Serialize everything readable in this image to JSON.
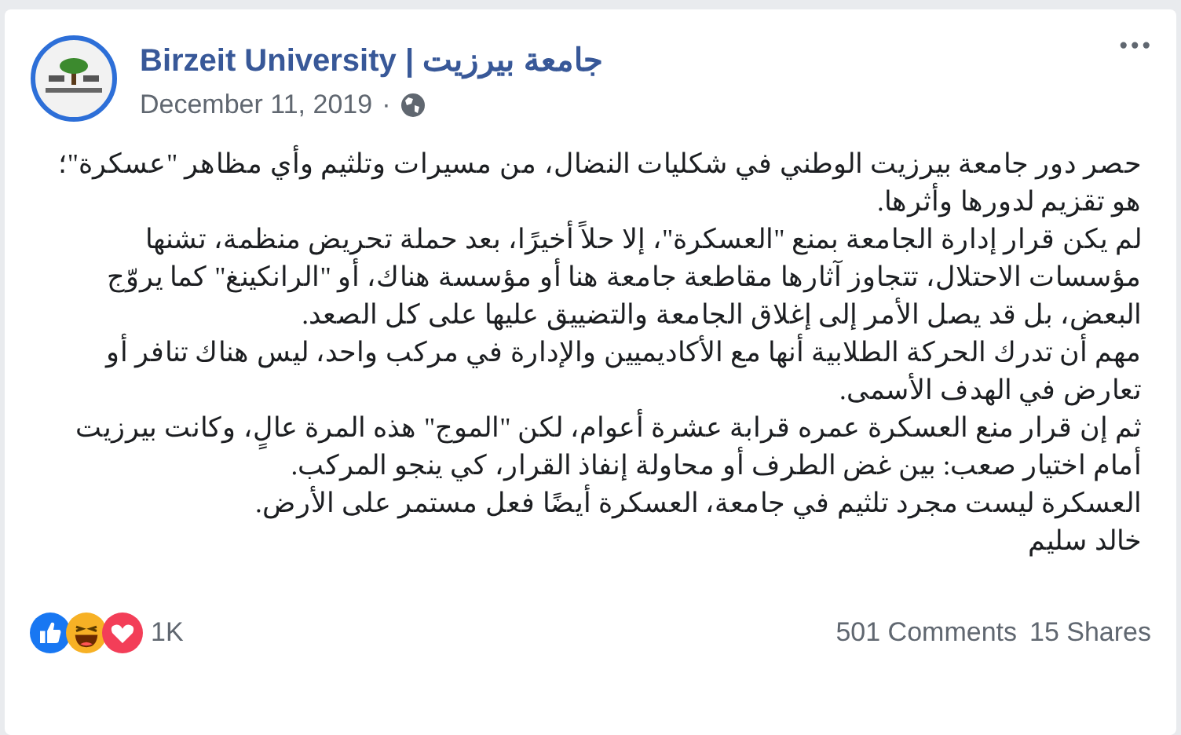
{
  "post": {
    "author": "Birzeit University | جامعة بيرزيت",
    "date": "December 11, 2019",
    "separator": "·",
    "more": "•••",
    "paragraphs": [
      "حصر دور جامعة بيرزيت الوطني في شكليات النضال، من مسيرات وتلثيم وأي مظاهر \"عسكرة\"؛ هو تقزيم لدورها وأثرها.",
      "لم يكن قرار إدارة الجامعة بمنع \"العسكرة\"، إلا حلاً أخيرًا، بعد حملة تحريض منظمة، تشنها مؤسسات الاحتلال، تتجاوز آثارها مقاطعة جامعة هنا أو مؤسسة هناك، أو \"الرانكينغ\" كما يروّج البعض، بل قد يصل الأمر إلى إغلاق الجامعة والتضييق عليها على كل الصعد.",
      "مهم أن تدرك الحركة الطلابية أنها مع الأكاديميين والإدارة في مركب واحد، ليس هناك تنافر أو تعارض في الهدف الأسمى.",
      "ثم إن قرار منع العسكرة عمره قرابة عشرة أعوام، لكن \"الموج\" هذه المرة عالٍ، وكانت بيرزيت أمام اختيار صعب: بين غض الطرف أو محاولة إنفاذ القرار، كي ينجو المركب.",
      "العسكرة ليست مجرد تلثيم في جامعة، العسكرة أيضًا فعل مستمر على الأرض.",
      "خالد سليم"
    ],
    "reactions": [
      {
        "kind": "like"
      },
      {
        "kind": "haha"
      },
      {
        "kind": "love"
      }
    ],
    "reaction_count": "1K",
    "comments": "501 Comments",
    "shares": "15 Shares"
  }
}
